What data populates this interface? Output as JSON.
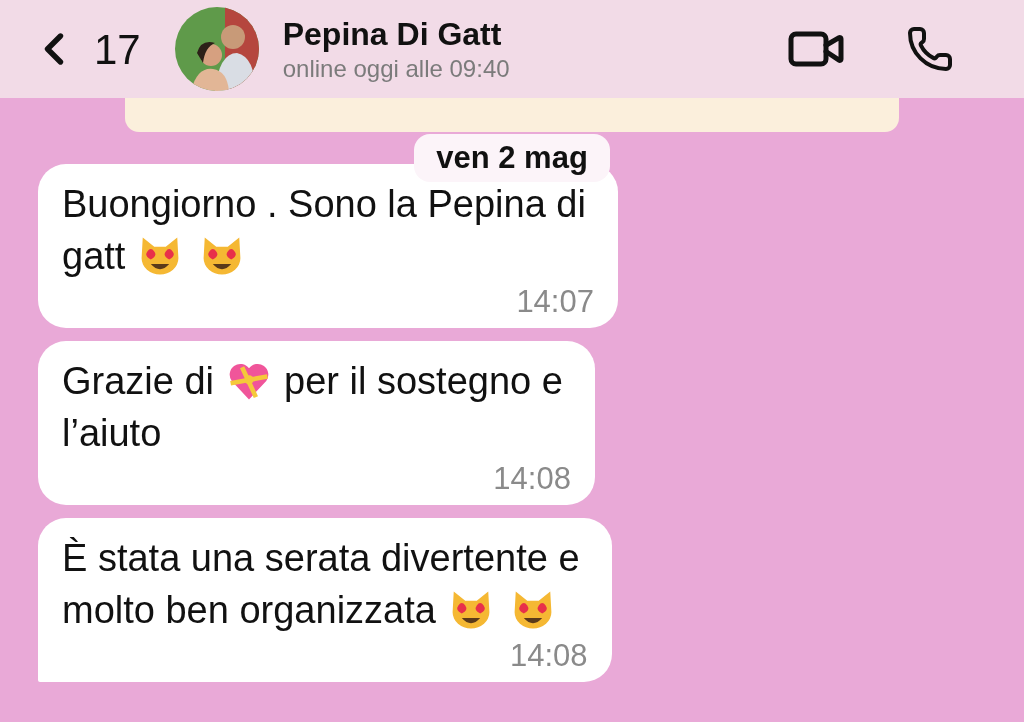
{
  "header": {
    "back_count": "17",
    "contact_name": "Pepina Di Gatt",
    "status": "online oggi alle 09:40"
  },
  "date_separator": "ven 2 mag",
  "messages": [
    {
      "lines": [
        [
          {
            "kind": "text",
            "text": "Buongiorno . Sono la Pepina di"
          }
        ],
        [
          {
            "kind": "text",
            "text": "gatt"
          },
          {
            "kind": "cat-emoji"
          },
          {
            "kind": "cat-emoji"
          }
        ]
      ],
      "time": "14:07",
      "tail": false
    },
    {
      "lines": [
        [
          {
            "kind": "text",
            "text": "Grazie di"
          },
          {
            "kind": "heart-emoji"
          },
          {
            "kind": "text",
            "text": "per il sostegno e"
          }
        ],
        [
          {
            "kind": "text",
            "text": "l’aiuto"
          }
        ]
      ],
      "time": "14:08",
      "tail": false
    },
    {
      "lines": [
        [
          {
            "kind": "text",
            "text": "È stata una serata divertente e"
          }
        ],
        [
          {
            "kind": "text",
            "text": "molto ben organizzata"
          },
          {
            "kind": "cat-emoji"
          },
          {
            "kind": "cat-emoji"
          }
        ]
      ],
      "time": "14:08",
      "tail": true
    }
  ]
}
